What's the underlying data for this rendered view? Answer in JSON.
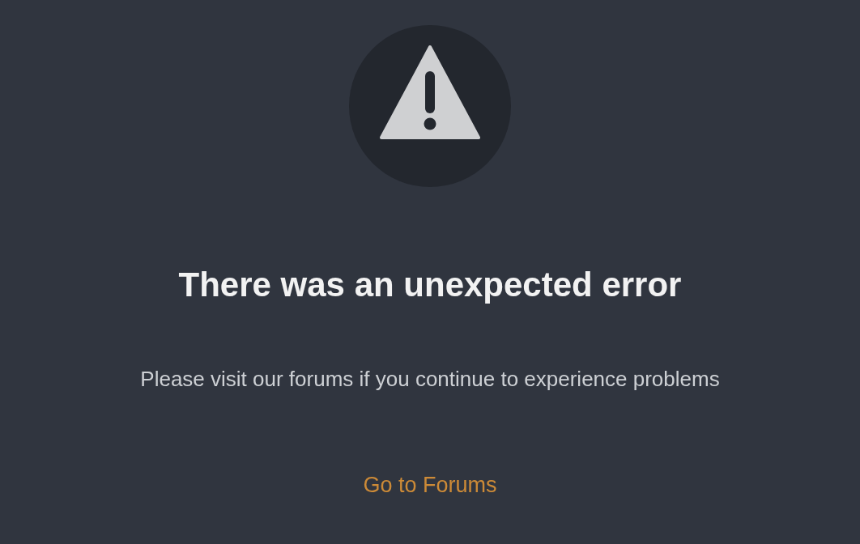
{
  "error_icon": {
    "kind": "warning"
  },
  "title": "There was an unexpected error",
  "message": "Please visit our forums if you continue to experience problems",
  "link": {
    "label": "Go to Forums"
  }
}
